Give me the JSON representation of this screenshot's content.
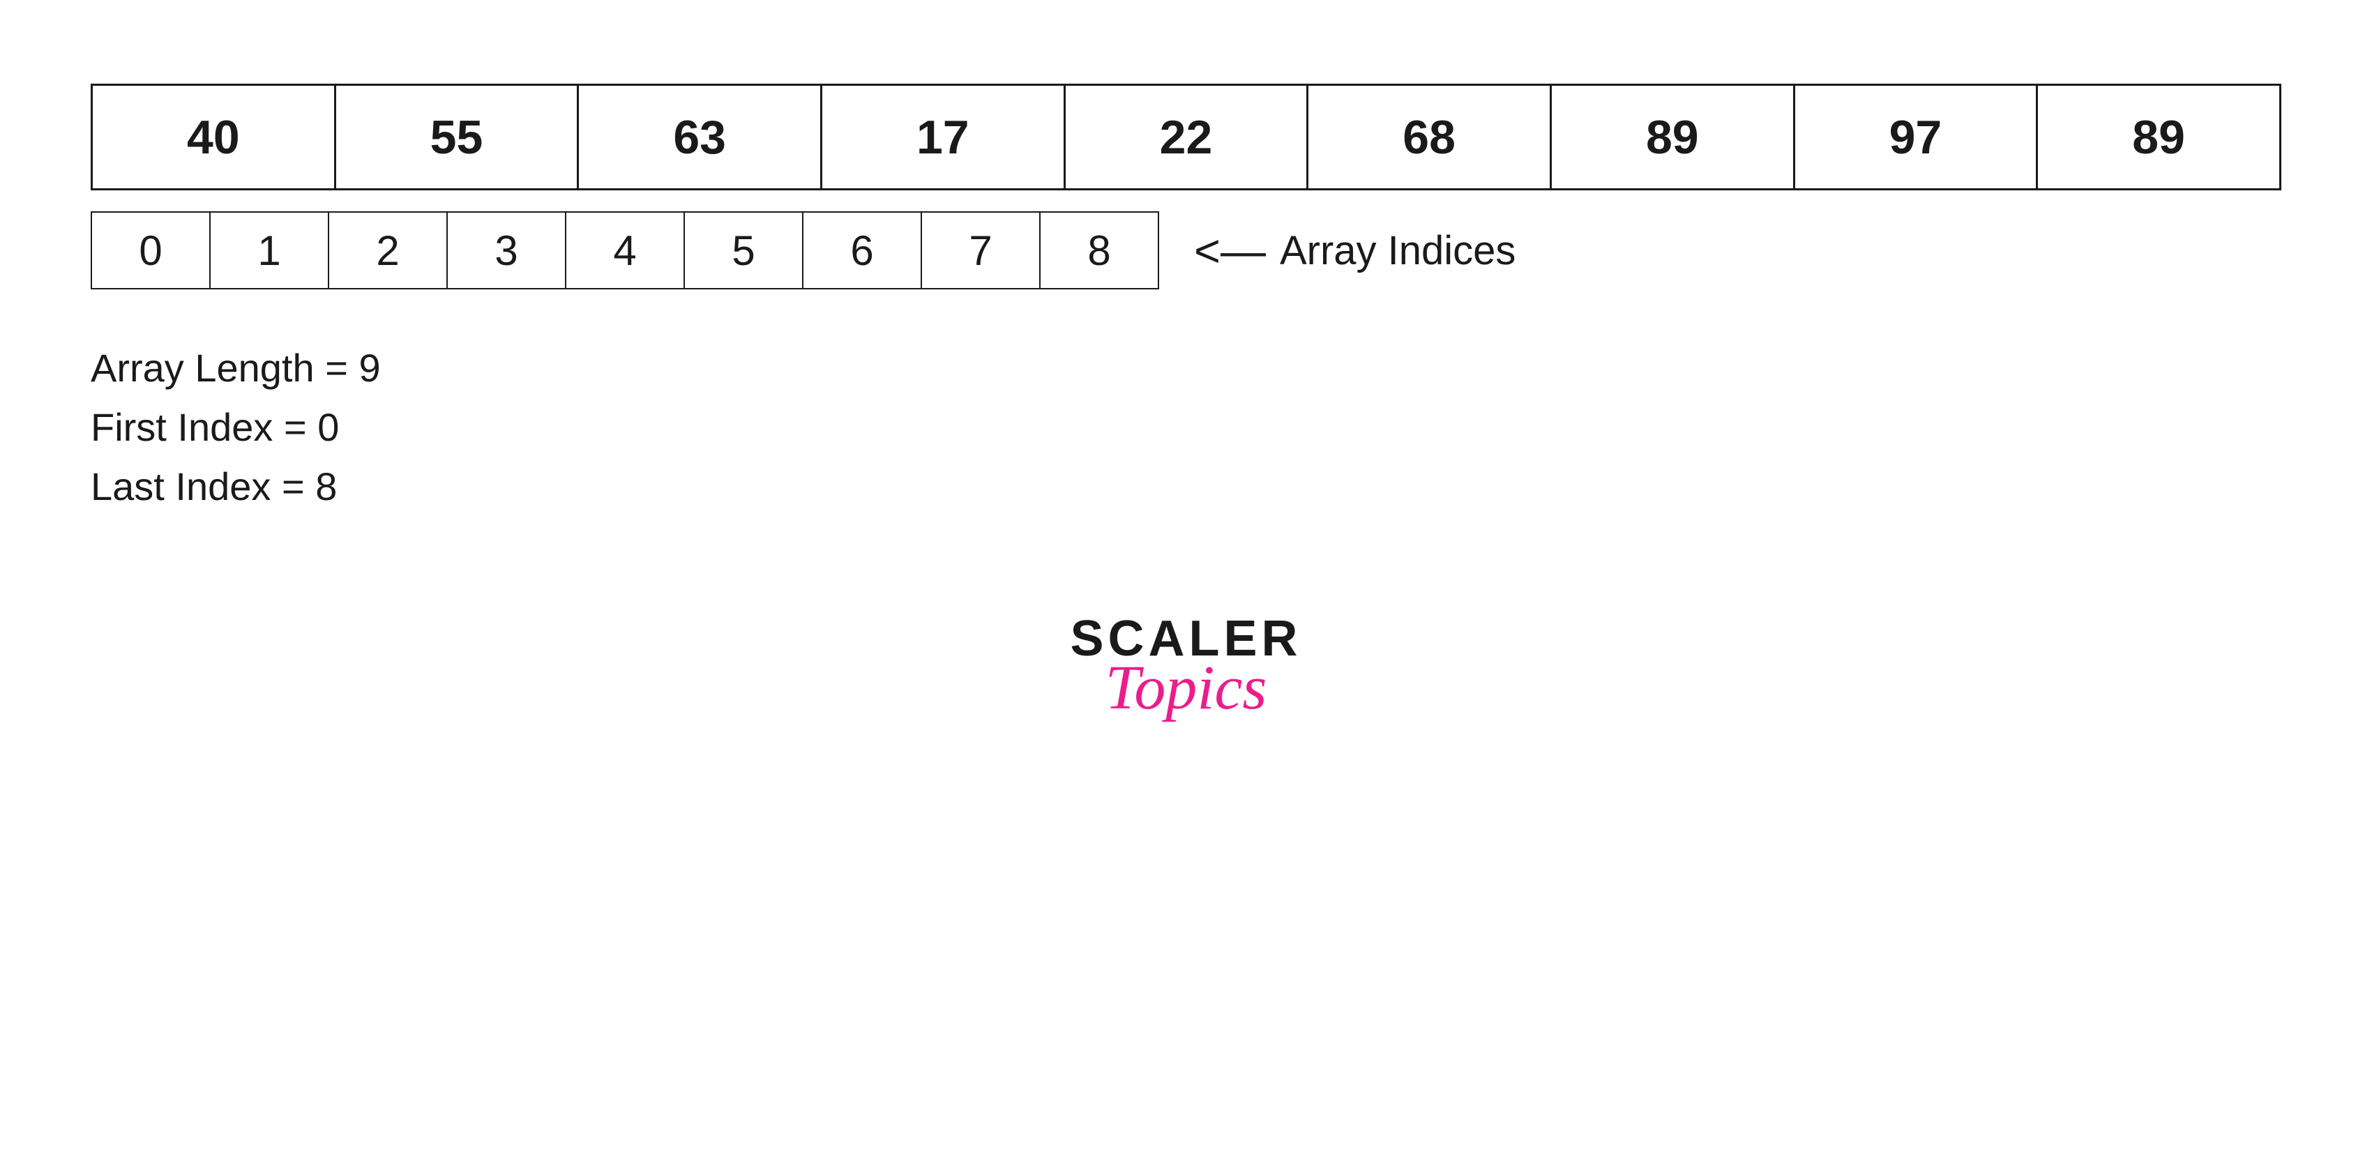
{
  "array": {
    "values": [
      40,
      55,
      63,
      17,
      22,
      68,
      89,
      97,
      89
    ],
    "indices": [
      0,
      1,
      2,
      3,
      4,
      5,
      6,
      7,
      8
    ]
  },
  "arrow": {
    "symbol": "<—",
    "label": "Array Indices"
  },
  "info": {
    "length_label": "Array Length = 9",
    "first_index_label": "First Index = 0",
    "last_index_label": "Last Index  = 8"
  },
  "logo": {
    "scaler": "SCALER",
    "topics": "Topics"
  }
}
